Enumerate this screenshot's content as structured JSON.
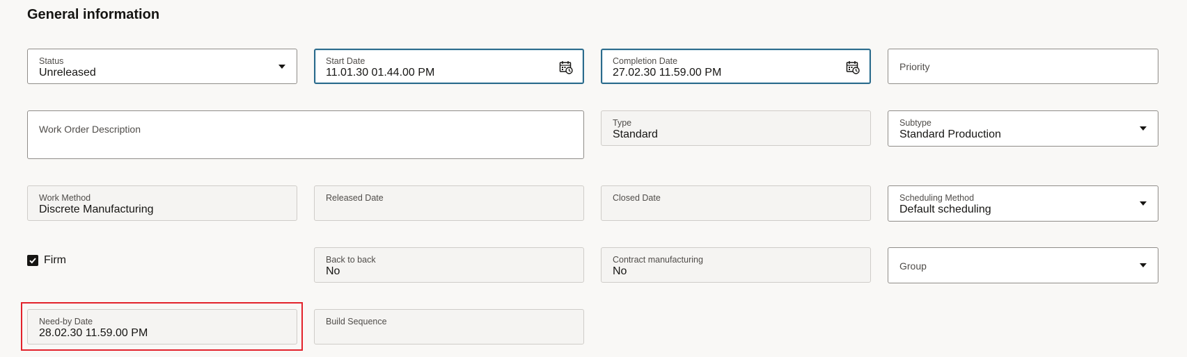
{
  "section": {
    "title": "General information"
  },
  "fields": {
    "status": {
      "label": "Status",
      "value": "Unreleased"
    },
    "start_date": {
      "label": "Start Date",
      "value": "11.01.30 01.44.00 PM"
    },
    "completion_date": {
      "label": "Completion Date",
      "value": "27.02.30 11.59.00 PM"
    },
    "priority": {
      "placeholder": "Priority"
    },
    "work_order_description": {
      "placeholder": "Work Order Description"
    },
    "type": {
      "label": "Type",
      "value": "Standard"
    },
    "subtype": {
      "label": "Subtype",
      "value": "Standard Production"
    },
    "work_method": {
      "label": "Work Method",
      "value": "Discrete Manufacturing"
    },
    "released_date": {
      "label": "Released Date"
    },
    "closed_date": {
      "label": "Closed Date"
    },
    "scheduling_method": {
      "label": "Scheduling Method",
      "value": "Default scheduling"
    },
    "firm": {
      "label": "Firm",
      "checked": true
    },
    "back_to_back": {
      "label": "Back to back",
      "value": "No"
    },
    "contract_manufacturing": {
      "label": "Contract manufacturing",
      "value": "No"
    },
    "group": {
      "placeholder": "Group"
    },
    "need_by_date": {
      "label": "Need-by Date",
      "value": "28.02.30 11.59.00 PM"
    },
    "build_sequence": {
      "label": "Build Sequence"
    }
  },
  "icons": {
    "dropdown": "chevron-down-icon",
    "calendar": "calendar-clock-icon",
    "checkbox": "check-icon"
  },
  "colors": {
    "focus_border": "#2b6b8c",
    "highlight_border": "#e2222b",
    "background": "#f9f8f6"
  }
}
